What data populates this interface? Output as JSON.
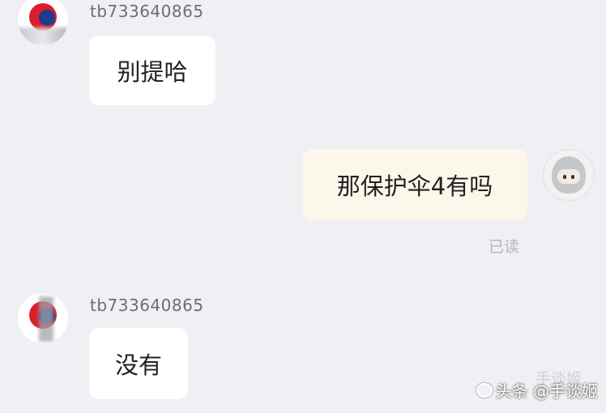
{
  "messages": [
    {
      "direction": "incoming",
      "sender": "tb733640865",
      "text": "别提哈",
      "avatar_icon": "store-logo-avatar"
    },
    {
      "direction": "outgoing",
      "text": "那保护伞4有吗",
      "status": "已读",
      "avatar_icon": "knight-helmet-avatar"
    },
    {
      "direction": "incoming",
      "sender": "tb733640865",
      "text": "没有",
      "avatar_icon": "store-logo-avatar"
    }
  ],
  "watermark": {
    "text": "头条 @手谈姬",
    "ghost_text": "手谈姬"
  },
  "colors": {
    "background": "#eef0f3",
    "incoming_bubble": "#ffffff",
    "outgoing_bubble": "#fbf7ea"
  }
}
